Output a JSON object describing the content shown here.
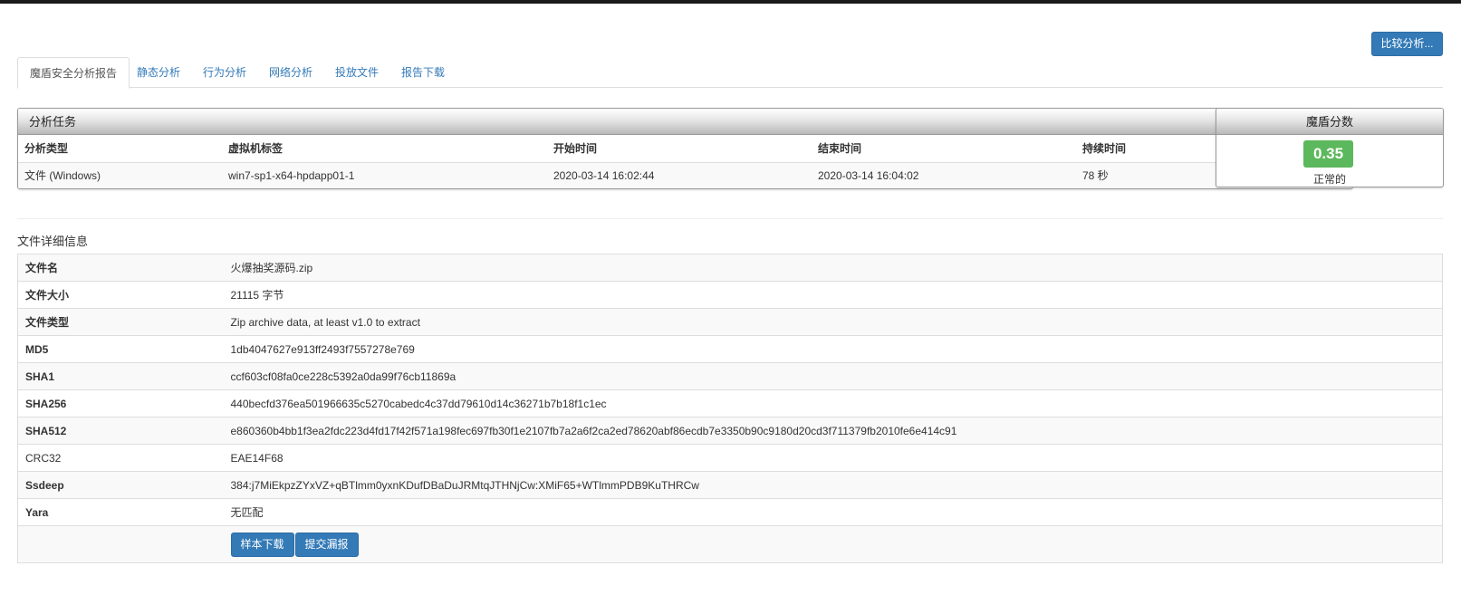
{
  "header": {
    "compare_label": "比较分析..."
  },
  "tabs": [
    {
      "label": "魔盾安全分析报告",
      "active": true
    },
    {
      "label": "静态分析"
    },
    {
      "label": "行为分析"
    },
    {
      "label": "网络分析"
    },
    {
      "label": "投放文件"
    },
    {
      "label": "报告下载"
    }
  ],
  "task": {
    "title": "分析任务",
    "columns": [
      "分析类型",
      "虚拟机标签",
      "开始时间",
      "结束时间",
      "持续时间"
    ],
    "row": [
      "文件 (Windows)",
      "win7-sp1-x64-hpdapp01-1",
      "2020-03-14 16:02:44",
      "2020-03-14 16:04:02",
      "78 秒"
    ]
  },
  "score": {
    "title": "魔盾分数",
    "value": "0.35",
    "label": "正常的",
    "color": "#5cb85c"
  },
  "file_details": {
    "title": "文件详细信息",
    "rows": [
      {
        "key": "文件名",
        "value": "火爆抽奖源码.zip"
      },
      {
        "key": "文件大小",
        "value": "21115 字节"
      },
      {
        "key": "文件类型",
        "value": "Zip archive data, at least v1.0 to extract"
      },
      {
        "key": "MD5",
        "value": "1db4047627e913ff2493f7557278e769"
      },
      {
        "key": "SHA1",
        "value": "ccf603cf08fa0ce228c5392a0da99f76cb11869a"
      },
      {
        "key": "SHA256",
        "value": "440becfd376ea501966635c5270cabedc4c37dd79610d14c36271b7b18f1c1ec"
      },
      {
        "key": "SHA512",
        "value": "e860360b4bb1f3ea2fdc223d4fd17f42f571a198fec697fb30f1e2107fb7a2a6f2ca2ed78620abf86ecdb7e3350b90c9180d20cd3f711379fb2010fe6e414c91"
      },
      {
        "key": "CRC32",
        "value": "EAE14F68"
      },
      {
        "key": "Ssdeep",
        "value": "384:j7MiEkpzZYxVZ+qBTlmm0yxnKDufDBaDuJRMtqJTHNjCw:XMiF65+WTlmmPDB9KuTHRCw"
      },
      {
        "key": "Yara",
        "value": "无匹配"
      }
    ],
    "download_label": "样本下载",
    "report_label": "提交漏报"
  },
  "colors": {
    "primary": "#337ab7",
    "success": "#5cb85c"
  }
}
